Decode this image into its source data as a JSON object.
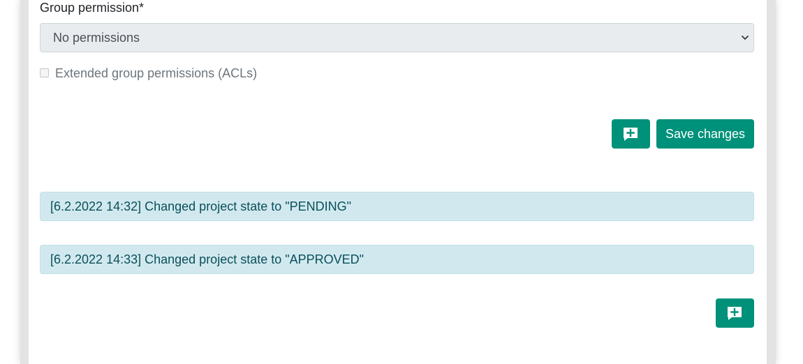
{
  "form": {
    "group_permission_label": "Group permission*",
    "group_permission_value": "No permissions",
    "extended_acl_label": "Extended group permissions (ACLs)",
    "extended_acl_checked": false
  },
  "actions": {
    "add_comment_icon": "add-comment-icon",
    "save_label": "Save changes"
  },
  "log": [
    {
      "text": "[6.2.2022 14:32] Changed project state to \"PENDING\""
    },
    {
      "text": "[6.2.2022 14:33] Changed project state to \"APPROVED\""
    }
  ],
  "colors": {
    "primary": "#00917a",
    "info_bg": "#d1e9ee",
    "info_text": "#0b4f5b"
  }
}
